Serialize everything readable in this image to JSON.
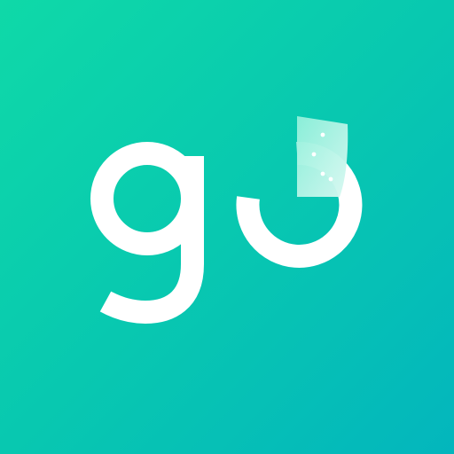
{
  "app_icon": {
    "logo_text": "go",
    "background_colors": [
      "#0fd9a8",
      "#03b6bd"
    ],
    "logo_color": "#ffffff"
  }
}
